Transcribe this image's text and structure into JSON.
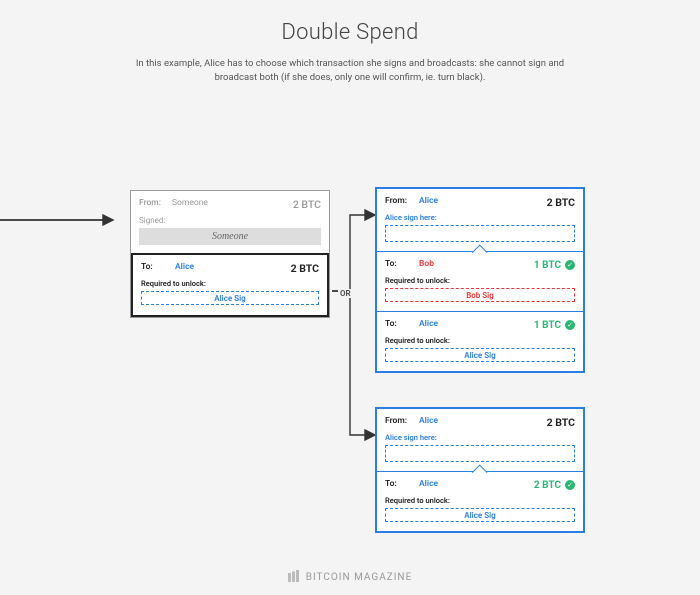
{
  "title": "Double Spend",
  "description": "In this example, Alice has to choose which transaction she signs and broadcasts: she cannot sign and broadcast both (if she does, only one will confirm, ie. turn black).",
  "or_label": "OR",
  "labels": {
    "from": "From:",
    "to": "To:",
    "signed": "Signed:",
    "sign_here": "Alice sign here:",
    "required": "Required to unlock:"
  },
  "original": {
    "from_name": "Someone",
    "from_amount": "2 BTC",
    "signature": "Someone",
    "to_name": "Alice",
    "to_amount": "2 BTC",
    "unlock_sig": "Alice Sig"
  },
  "option1": {
    "from_name": "Alice",
    "from_amount": "2 BTC",
    "out1": {
      "to": "Bob",
      "amount": "1 BTC",
      "sig": "Bob Sig"
    },
    "out2": {
      "to": "Alice",
      "amount": "1 BTC",
      "sig": "Alice Sig"
    }
  },
  "option2": {
    "from_name": "Alice",
    "from_amount": "2 BTC",
    "out1": {
      "to": "Alice",
      "amount": "2 BTC",
      "sig": "Alice Sig"
    }
  },
  "footer": "BITCOIN MAGAZINE"
}
